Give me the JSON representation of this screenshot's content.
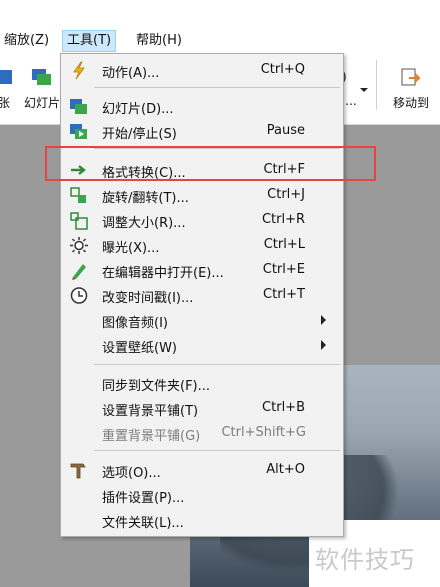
{
  "menubar": {
    "zoom": "缩放(Z)",
    "tools": "工具(T)",
    "help": "帮助(H)"
  },
  "toolbar": {
    "partial_left": "张",
    "slideshow": "幻灯片",
    "move_to": "移动到",
    "partial_mid": "..."
  },
  "menu": {
    "items": [
      {
        "label": "动作(A)...",
        "accel": "Ctrl+Q",
        "icon": "lightning-icon"
      },
      {
        "label": "幻灯片(D)...",
        "accel": "",
        "icon": "slideshow-icon"
      },
      {
        "label": "开始/停止(S)",
        "accel": "Pause",
        "icon": "start-stop-icon"
      },
      {
        "label": "格式转换(C)...",
        "accel": "Ctrl+F",
        "icon": "convert-icon"
      },
      {
        "label": "旋转/翻转(T)...",
        "accel": "Ctrl+J",
        "icon": "rotate-icon"
      },
      {
        "label": "调整大小(R)...",
        "accel": "Ctrl+R",
        "icon": "resize-icon"
      },
      {
        "label": "曝光(X)...",
        "accel": "Ctrl+L",
        "icon": "exposure-icon"
      },
      {
        "label": "在编辑器中打开(E)...",
        "accel": "Ctrl+E",
        "icon": "editor-icon"
      },
      {
        "label": "改变时间戳(I)...",
        "accel": "Ctrl+T",
        "icon": "clock-icon"
      },
      {
        "label": "图像音频(I)",
        "accel": "",
        "icon": ""
      },
      {
        "label": "设置壁纸(W)",
        "accel": "",
        "icon": ""
      },
      {
        "label": "同步到文件夹(F)...",
        "accel": "",
        "icon": ""
      },
      {
        "label": "设置背景平铺(T)",
        "accel": "Ctrl+B",
        "icon": ""
      },
      {
        "label": "重置背景平铺(G)",
        "accel": "Ctrl+Shift+G",
        "icon": ""
      },
      {
        "label": "选项(O)...",
        "accel": "Alt+O",
        "icon": "options-icon"
      },
      {
        "label": "插件设置(P)...",
        "accel": "",
        "icon": ""
      },
      {
        "label": "文件关联(L)...",
        "accel": "",
        "icon": ""
      }
    ]
  },
  "watermark": "软件技巧",
  "colors": {
    "menu_bg": "#f2f2f2",
    "highlight_border": "#e64545",
    "menubar_active": "#cce8ff"
  }
}
